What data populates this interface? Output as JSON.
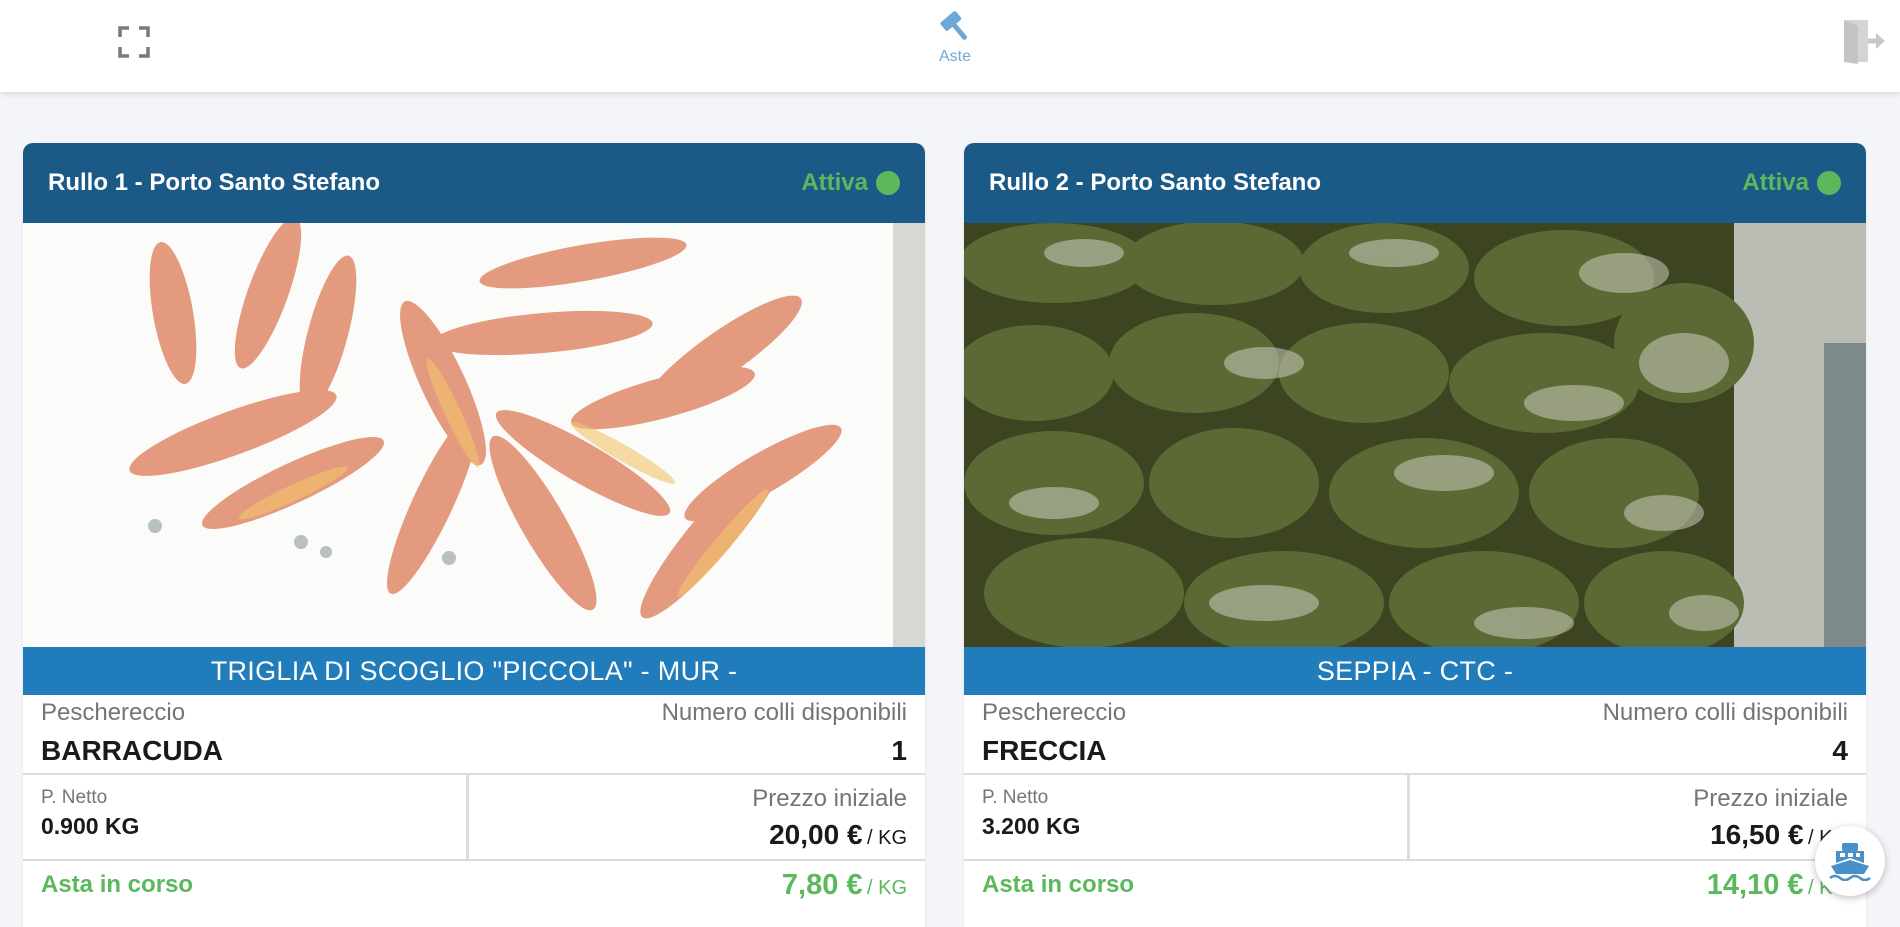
{
  "header": {
    "nav_label": "Aste",
    "fullscreen_icon": "fullscreen-icon",
    "gavel_icon": "gavel-icon",
    "logout_icon": "logout-icon"
  },
  "colors": {
    "header_blue": "#1b5a87",
    "product_bar_blue": "#207cba",
    "active_green": "#5cb85c",
    "nav_blue": "#6ea8d6"
  },
  "auctions": [
    {
      "title": "Rullo 1 - Porto Santo Stefano",
      "status": "Attiva",
      "photo": "red mullet fish in white crate",
      "product": "TRIGLIA DI SCOGLIO \"PICCOLA\" - MUR -",
      "boat_label": "Peschereccio",
      "boat": "BARRACUDA",
      "packages_label": "Numero colli disponibili",
      "packages": "1",
      "net_label": "P. Netto",
      "net": "0.900 KG",
      "start_price_label": "Prezzo iniziale",
      "start_price": "20,00 €",
      "start_unit": "/ KG",
      "auction_label": "Asta in corso",
      "current_price": "7,80 €",
      "current_unit": "/ KG"
    },
    {
      "title": "Rullo 2 - Porto Santo Stefano",
      "status": "Attiva",
      "photo": "cuttlefish in ink in crate",
      "product": "SEPPIA - CTC -",
      "boat_label": "Peschereccio",
      "boat": "FRECCIA",
      "packages_label": "Numero colli disponibili",
      "packages": "4",
      "net_label": "P. Netto",
      "net": "3.200 KG",
      "start_price_label": "Prezzo iniziale",
      "start_price": "16,50 €",
      "start_unit": "/ KG",
      "auction_label": "Asta in corso",
      "current_price": "14,10 €",
      "current_unit": "/ KG"
    }
  ],
  "floating_button": {
    "icon": "ship-icon"
  }
}
